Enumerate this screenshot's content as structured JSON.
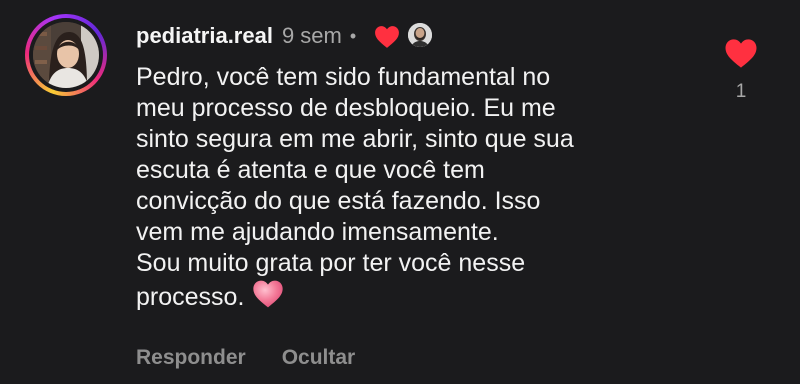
{
  "comment": {
    "username": "pediatria.real",
    "time": "9 sem",
    "separator": "•",
    "text": "Pedro, você tem sido fundamental no\nmeu processo de desbloqueio. Eu me\nsinto segura em me abrir, sinto que sua\nescuta é atenta e que você tem\nconvicção do que está fazendo. Isso\nvem me ajudando imensamente.\nSou muito grata por ter você nesse\nprocesso.",
    "emoji": "pink-heart",
    "creator_liked": true
  },
  "actions": {
    "reply_label": "Responder",
    "hide_label": "Ocultar"
  },
  "likes": {
    "count": "1",
    "liked": true,
    "icon": "heart-filled-icon"
  },
  "colors": {
    "background": "#1b1b1d",
    "text": "#f2f2f2",
    "muted": "#a8a8a8",
    "action": "#8e8e8e",
    "like_red": "#ff3040",
    "emoji_pink": "#f26d8f"
  }
}
